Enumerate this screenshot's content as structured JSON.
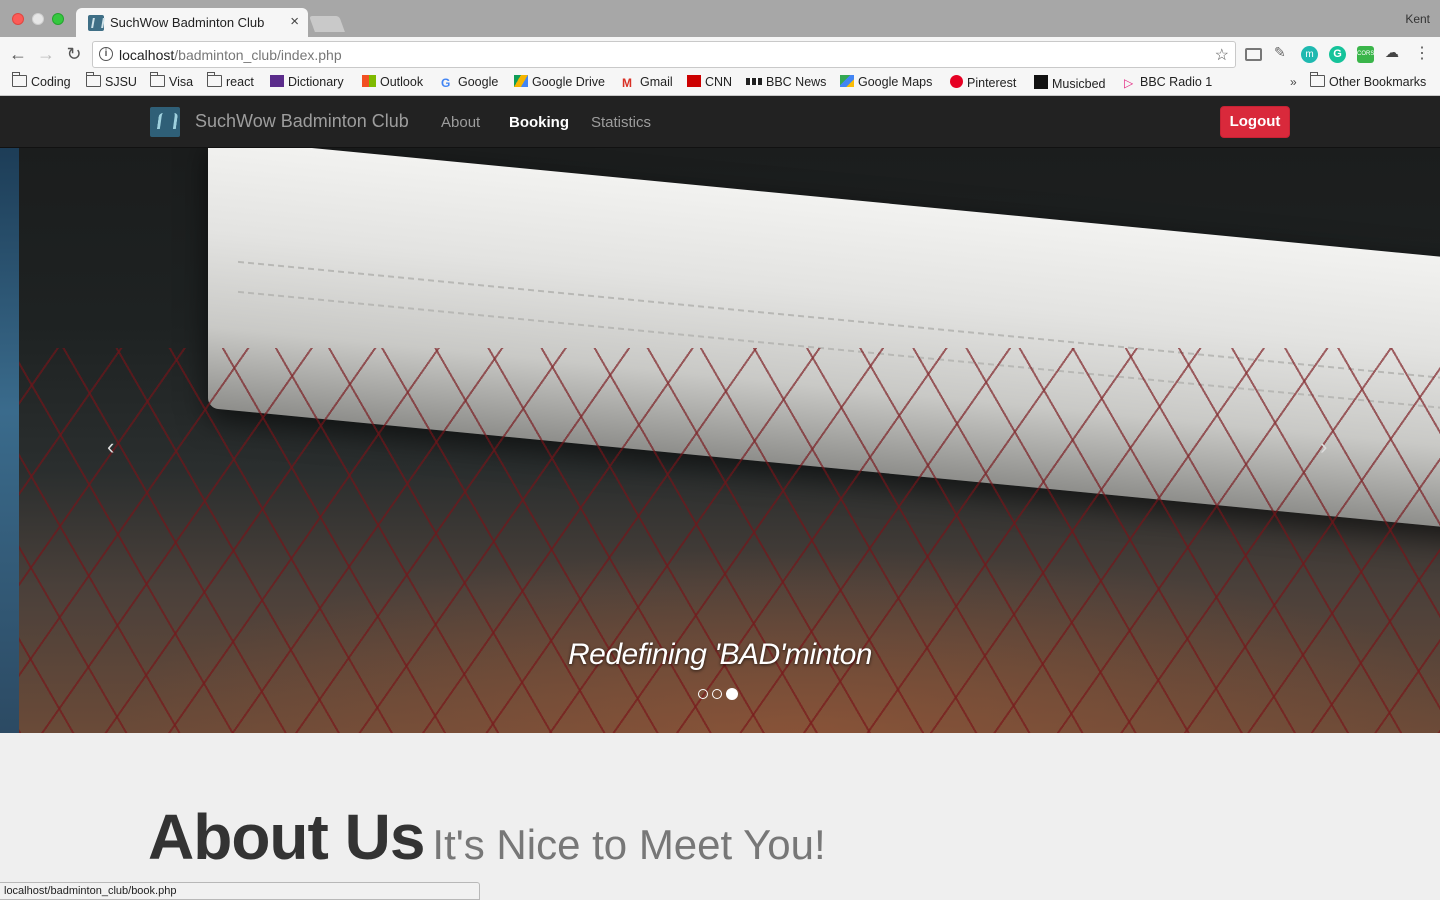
{
  "browser": {
    "tab_title": "SuchWow Badminton Club",
    "tab_close": "×",
    "profile_name": "Kent",
    "url_host": "localhost",
    "url_path": "/badminton_club/index.php",
    "bookmarks": [
      "Coding",
      "SJSU",
      "Visa",
      "react",
      "Dictionary",
      "Outlook",
      "Google",
      "Google Drive",
      "Gmail",
      "CNN",
      "BBC News",
      "Google Maps",
      "Pinterest",
      "Musicbed",
      "BBC Radio 1"
    ],
    "other_bookmarks": "Other Bookmarks",
    "more_bookmarks": "»",
    "status_url": "localhost/badminton_club/book.php"
  },
  "navbar": {
    "brand": "SuchWow Badminton Club",
    "links": [
      "About",
      "Booking",
      "Statistics"
    ],
    "active_link": "Booking",
    "logout_label": "Logout",
    "logout_color": "#d9293b"
  },
  "carousel": {
    "caption": "Redefining 'BAD'minton",
    "prev_icon": "‹",
    "next_icon": "›",
    "slide_count": 3,
    "active_index": 2
  },
  "about": {
    "title": "About Us",
    "subtitle": "It's Nice to Meet You!"
  }
}
